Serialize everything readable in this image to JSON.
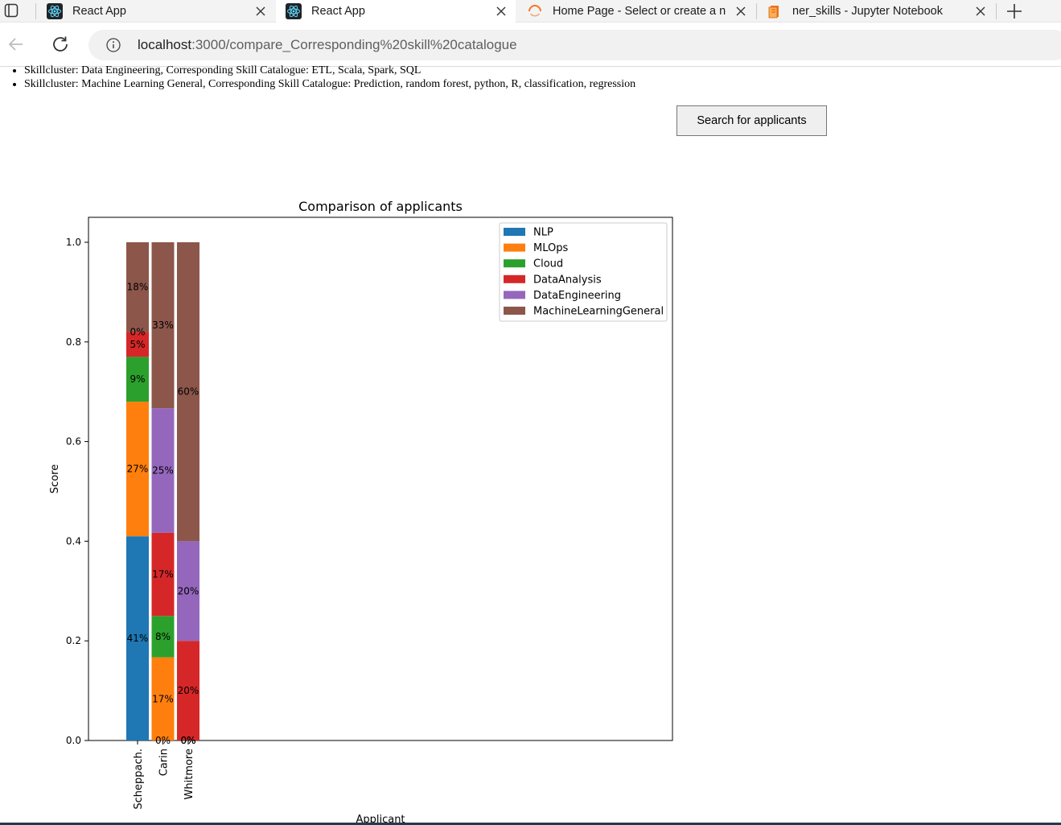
{
  "browser": {
    "tabs": [
      {
        "title": "React App",
        "icon": "react-icon",
        "active": false
      },
      {
        "title": "React App",
        "icon": "react-icon",
        "active": true
      },
      {
        "title": "Home Page - Select or create a n",
        "icon": "loading-spinner-icon",
        "active": false
      },
      {
        "title": "ner_skills - Jupyter Notebook",
        "icon": "notebook-icon",
        "active": false
      }
    ],
    "url_host": "localhost",
    "url_path": ":3000/compare_Corresponding%20skill%20catalogue"
  },
  "page": {
    "skillclusters": [
      "Skillcluster: Data Engineering, Corresponding Skill Catalogue: ETL, Scala, Spark, SQL",
      "Skillcluster: Machine Learning General, Corresponding Skill Catalogue: Prediction, random forest, python, R, classification, regression"
    ],
    "search_button": "Search for applicants"
  },
  "chart_data": {
    "type": "bar",
    "stacked": true,
    "title": "Comparison of applicants",
    "xlabel": "Applicant",
    "ylabel": "Score",
    "ylim": [
      0,
      1.0
    ],
    "yticks": [
      "0.0",
      "0.2",
      "0.4",
      "0.6",
      "0.8",
      "1.0"
    ],
    "legend_position": "top-right",
    "categories": [
      "Scheppach.",
      "Carin",
      "Whitmore"
    ],
    "series": [
      {
        "name": "NLP",
        "color": "#1f77b4",
        "values": [
          0.41,
          0.0,
          0.0
        ],
        "labels": [
          "41%",
          "0%",
          "0%"
        ]
      },
      {
        "name": "MLOps",
        "color": "#ff7f0e",
        "values": [
          0.27,
          0.167,
          0.0
        ],
        "labels": [
          "27%",
          "17%",
          "0%"
        ]
      },
      {
        "name": "Cloud",
        "color": "#2ca02c",
        "values": [
          0.09,
          0.083,
          0.0
        ],
        "labels": [
          "9%",
          "8%",
          "0%"
        ]
      },
      {
        "name": "DataAnalysis",
        "color": "#d62728",
        "values": [
          0.05,
          0.167,
          0.2
        ],
        "labels": [
          "5%",
          "17%",
          "20%"
        ]
      },
      {
        "name": "DataEngineering",
        "color": "#9467bd",
        "values": [
          0.0,
          0.25,
          0.2
        ],
        "labels": [
          "0%",
          "25%",
          "20%"
        ]
      },
      {
        "name": "MachineLearningGeneral",
        "color": "#8c564b",
        "values": [
          0.18,
          0.333,
          0.6
        ],
        "labels": [
          "18%",
          "33%",
          "60%"
        ]
      }
    ]
  }
}
